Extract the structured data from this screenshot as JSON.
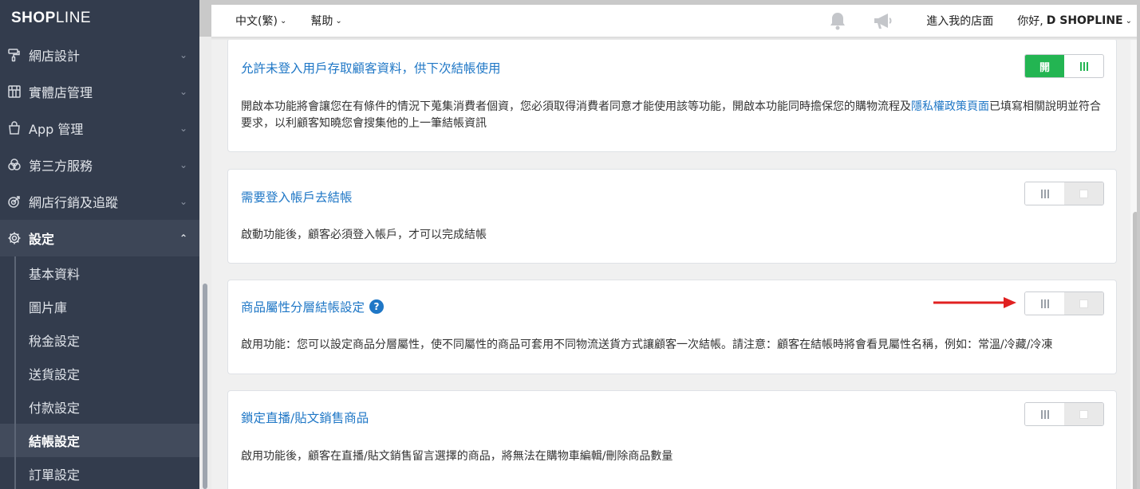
{
  "sidebar": {
    "logo": {
      "bold": "SHOP",
      "rest": "LINE"
    },
    "items": [
      {
        "label": "網店設計",
        "icon": "paint-roller-icon"
      },
      {
        "label": "實體店管理",
        "icon": "store-icon"
      },
      {
        "label": "App 管理",
        "icon": "shopping-bag-icon"
      },
      {
        "label": "第三方服務",
        "icon": "apps-circles-icon"
      },
      {
        "label": "網店行銷及追蹤",
        "icon": "target-icon"
      },
      {
        "label": "設定",
        "icon": "gear-icon"
      }
    ],
    "sub_items": [
      {
        "label": "基本資料"
      },
      {
        "label": "圖片庫"
      },
      {
        "label": "稅金設定"
      },
      {
        "label": "送貨設定"
      },
      {
        "label": "付款設定"
      },
      {
        "label": "結帳設定"
      },
      {
        "label": "訂單設定"
      }
    ]
  },
  "topbar": {
    "lang": "中文(繁)",
    "help": "幫助",
    "store_link": "進入我的店面",
    "greeting": "你好,",
    "username": "D SHOPLINE"
  },
  "cards": [
    {
      "title": "允許未登入用戶存取顧客資料，供下次結帳使用",
      "desc_before": "開啟本功能將會讓您在有條件的情況下蒐集消費者個資，您必須取得消費者同意才能使用該等功能，開啟本功能同時擔保您的購物流程及",
      "desc_link": "隱私權政策頁面",
      "desc_after": "已填寫相關說明並符合要求，以利顧客知曉您會搜集他的上一筆結帳資訊",
      "toggle_on": true,
      "toggle_on_label": "開"
    },
    {
      "title": "需要登入帳戶去結帳",
      "desc": "啟動功能後，顧客必須登入帳戶，才可以完成結帳",
      "toggle_on": false
    },
    {
      "title": "商品屬性分層結帳設定",
      "help_icon": "?",
      "desc": "啟用功能：您可以設定商品分層屬性，使不同屬性的商品可套用不同物流送貨方式讓顧客一次結帳。請注意：顧客在結帳時將會看見屬性名稱，例如：常溫/冷藏/冷凍",
      "toggle_on": false
    },
    {
      "title": "鎖定直播/貼文銷售商品",
      "desc": "啟用功能後，顧客在直播/貼文銷售留言選擇的商品，將無法在購物車編輯/刪除商品數量",
      "toggle_on": false
    }
  ],
  "colors": {
    "sidebar_bg": "#333c4d",
    "link_blue": "#1f77c6",
    "toggle_green": "#23b552",
    "annotation_red": "#e02020"
  }
}
